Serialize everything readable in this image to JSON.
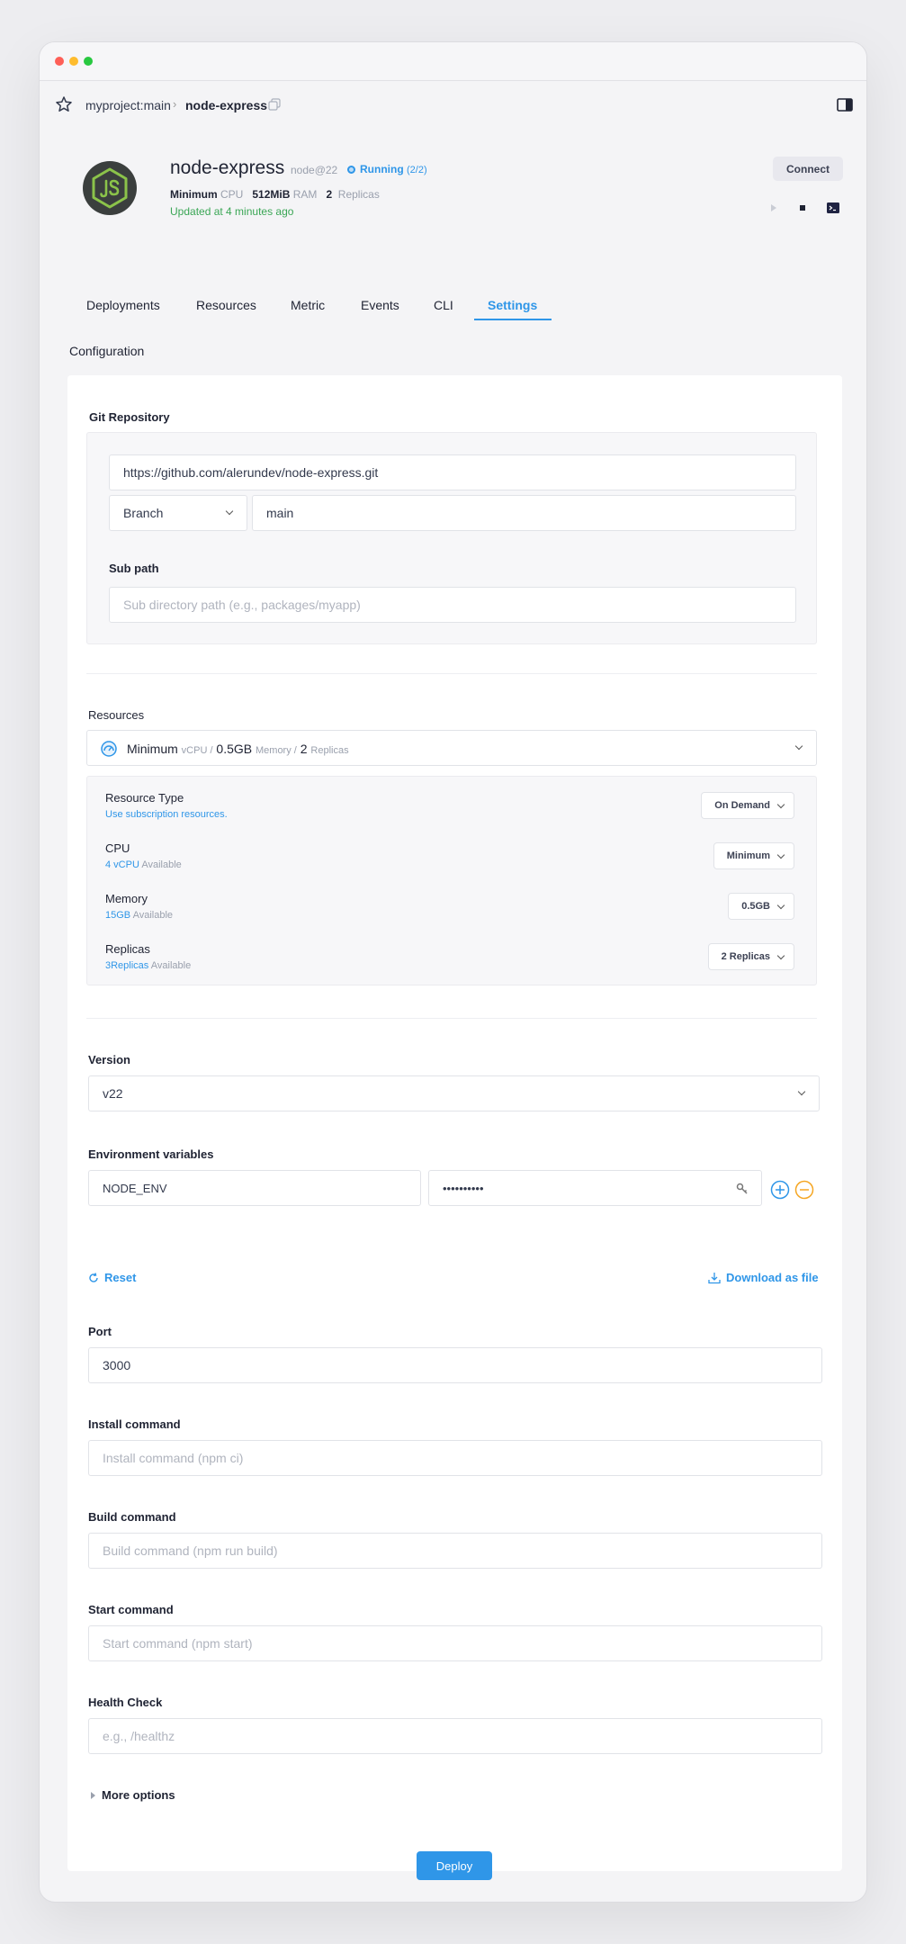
{
  "breadcrumb": {
    "project": "myproject:main",
    "separator": "›",
    "service": "node-express"
  },
  "header": {
    "name": "node-express",
    "runtime": "node@22",
    "status": "Running",
    "status_count": "(2/2)",
    "cpu_value": "Minimum",
    "cpu_label": "CPU",
    "ram_value": "512MiB",
    "ram_label": "RAM",
    "replicas_value": "2",
    "replicas_label": "Replicas",
    "updated": "Updated at 4 minutes ago",
    "connect_label": "Connect"
  },
  "tabs": [
    {
      "label": "Deployments"
    },
    {
      "label": "Resources"
    },
    {
      "label": "Metric"
    },
    {
      "label": "Events"
    },
    {
      "label": "CLI"
    },
    {
      "label": "Settings",
      "active": true
    }
  ],
  "section_title": "Configuration",
  "git": {
    "title": "Git Repository",
    "url": "https://github.com/alerundev/node-express.git",
    "ref_type": "Branch",
    "ref_value": "main",
    "subpath_label": "Sub path",
    "subpath_placeholder": "Sub directory path (e.g., packages/myapp)"
  },
  "resources": {
    "title": "Resources",
    "summary_cpu": "Minimum",
    "summary_cpu_unit": "vCPU /",
    "summary_mem": "0.5GB",
    "summary_mem_unit": "Memory /",
    "summary_rep": "2",
    "summary_rep_unit": "Replicas",
    "rows": [
      {
        "title": "Resource Type",
        "sub_hl": "Use subscription resources.",
        "sub": "",
        "value": "On Demand"
      },
      {
        "title": "CPU",
        "sub_hl": "4 vCPU",
        "sub": "Available",
        "value": "Minimum"
      },
      {
        "title": "Memory",
        "sub_hl": "15GB",
        "sub": "Available",
        "value": "0.5GB"
      },
      {
        "title": "Replicas",
        "sub_hl": "3Replicas",
        "sub": "Available",
        "value": "2 Replicas"
      }
    ]
  },
  "version": {
    "label": "Version",
    "value": "v22"
  },
  "env": {
    "label": "Environment variables",
    "key": "NODE_ENV",
    "value_masked": "••••••••••",
    "reset_label": "Reset",
    "download_label": "Download as file"
  },
  "port": {
    "label": "Port",
    "value": "3000"
  },
  "install": {
    "label": "Install command",
    "placeholder": "Install command (npm ci)"
  },
  "build": {
    "label": "Build command",
    "placeholder": "Build command (npm run build)"
  },
  "start": {
    "label": "Start command",
    "placeholder": "Start command (npm start)"
  },
  "health": {
    "label": "Health Check",
    "placeholder": "e.g., /healthz"
  },
  "more_options": "More options",
  "deploy_label": "Deploy",
  "colors": {
    "accent": "#2f96e8",
    "success": "#3aa655",
    "warning": "#f5a623"
  }
}
